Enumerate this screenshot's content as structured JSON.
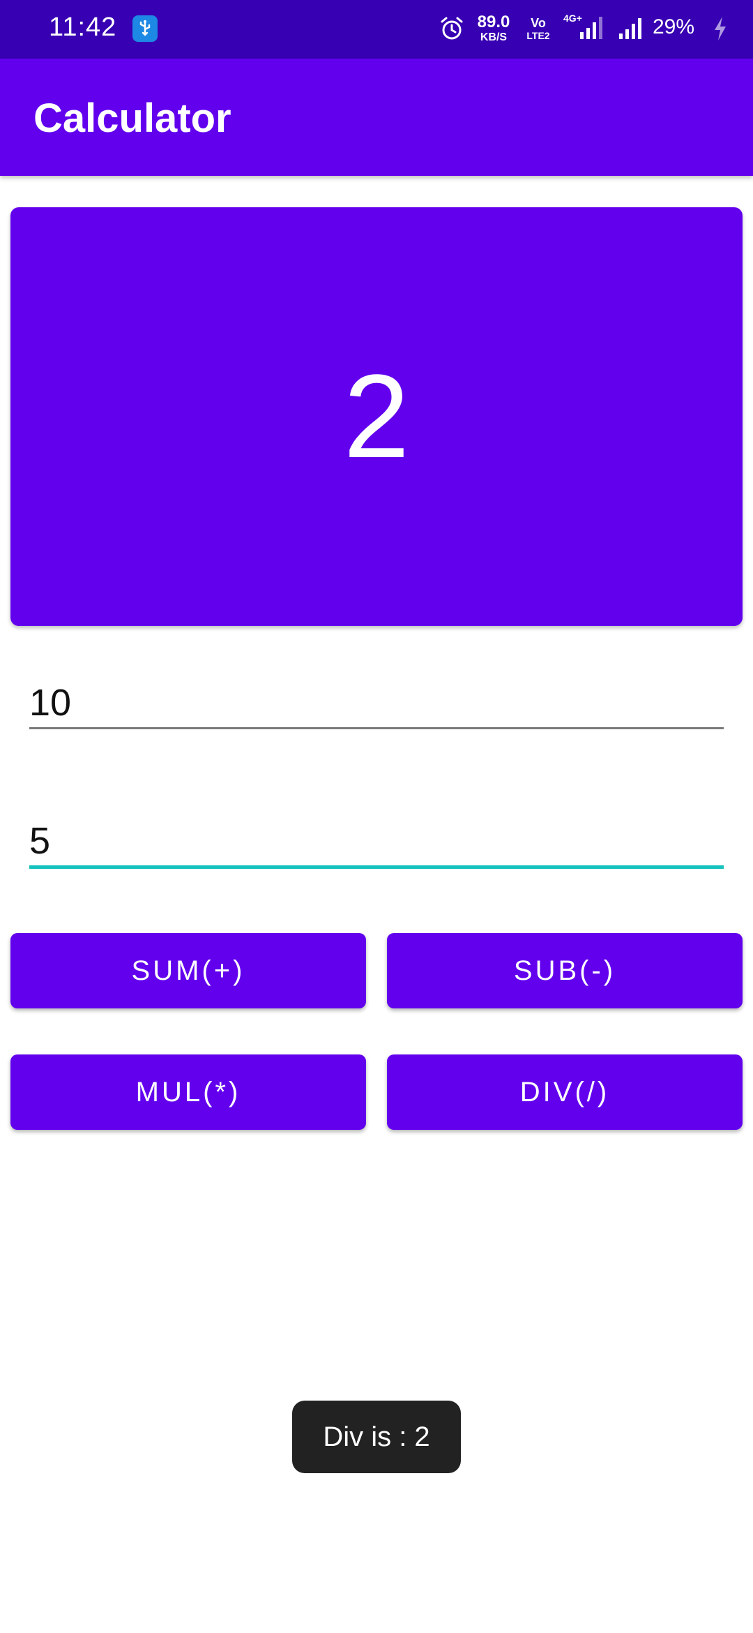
{
  "status_bar": {
    "time": "11:42",
    "net_speed_value": "89.0",
    "net_speed_unit": "KB/S",
    "volte_top": "Vo",
    "volte_bottom": "LTE2",
    "network_type": "4G+",
    "battery": "29%",
    "icons": [
      "usb-icon",
      "alarm-icon",
      "signal-icon",
      "charging-bolt-icon"
    ]
  },
  "app_bar": {
    "title": "Calculator"
  },
  "result": {
    "value": "2"
  },
  "inputs": {
    "first": "10",
    "second": "5"
  },
  "buttons": {
    "sum": "SUM(+)",
    "sub": "SUB(-)",
    "mul": "MUL(*)",
    "div": "DIV(/)"
  },
  "toast": {
    "message": "Div is : 2"
  },
  "colors": {
    "primary": "#6200ee",
    "primary_dark": "#3700b3",
    "accent": "#16c2be",
    "toast_bg": "#222222"
  }
}
